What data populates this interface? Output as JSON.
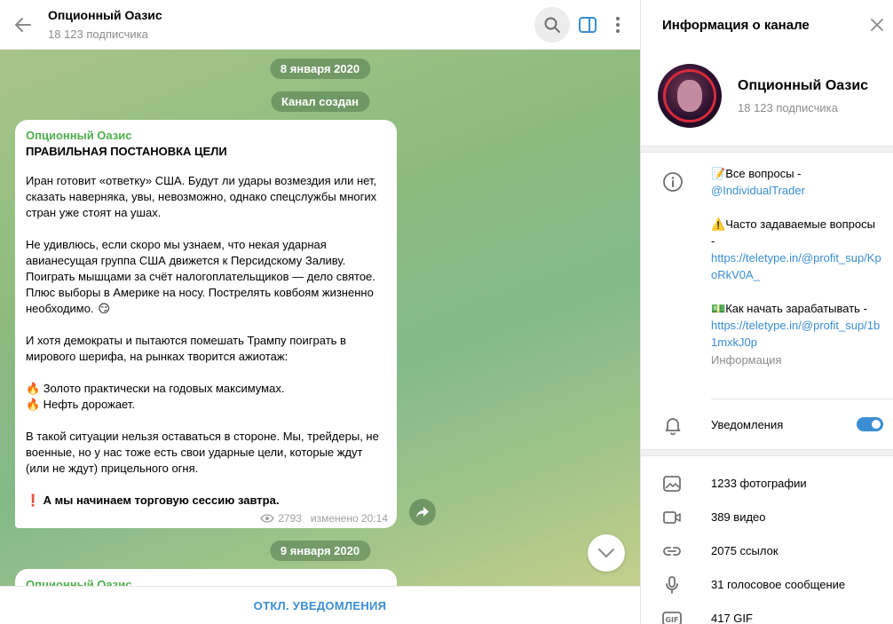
{
  "chat": {
    "title": "Опционный Оазис",
    "subscribers": "18 123 подписчика",
    "date_pill_1": "8 января 2020",
    "created_pill": "Канал создан",
    "date_pill_2": "9 января 2020",
    "bottom_action": "ОТКЛ. УВЕДОМЛЕНИЯ"
  },
  "message": {
    "author": "Опционный Оазис",
    "title": "ПРАВИЛЬНАЯ ПОСТАНОВКА ЦЕЛИ",
    "p1": "Иран готовит «ответку» США. Будут ли удары возмездия или нет, сказать наверняка, увы, невозможно, однако спецслужбы многих стран уже стоят на ушах.",
    "p2": "Не удивлюсь, если скоро мы узнаем, что некая ударная авианесущая группа США движется к Персидскому Заливу. Поиграть мышцами за счёт налогоплательщиков — дело святое. Плюс выборы в Америке на носу. Пострелять ковбоям жизненно необходимо.",
    "p2_emoji": "😏",
    "p3": "И хотя демократы и пытаются помешать Трампу поиграть в мирового шерифа, на рынках творится ажиотаж:",
    "bullet_emoji": "🔥",
    "bullet1": "Золото практически на годовых максимумах.",
    "bullet2": "Нефть дорожает.",
    "p4": "В такой ситуации нельзя оставаться в стороне. Мы, трейдеры, не военные, но у нас тоже есть свои ударные цели, которые ждут (или не ждут) прицельного огня.",
    "last_emoji": "❗",
    "last": "А мы начинаем торговую сессию завтра.",
    "views": "2793",
    "edited": "изменено 20:14"
  },
  "message2": {
    "author": "Опционный Оазис"
  },
  "info": {
    "header": "Информация о канале",
    "name": "Опционный Оазис",
    "subscribers": "18 123 подписчика",
    "about_line1_emoji": "📝",
    "about_line1": "Все вопросы -",
    "about_link1": "@IndividualTrader",
    "about_line2_emoji": "⚠️",
    "about_line2": "Часто задаваемые вопросы -",
    "about_link2": "https://teletype.in/@profit_sup/KpoRkV0A_",
    "about_line3_emoji": "💵",
    "about_line3": "Как начать зарабатывать -",
    "about_link3": "https://teletype.in/@profit_sup/1b1mxkJ0p",
    "about_label": "Информация",
    "notifications": "Уведомления",
    "notifications_on": true,
    "media": [
      {
        "label": "1233 фотографии",
        "icon": "photo-icon"
      },
      {
        "label": "389 видео",
        "icon": "video-icon"
      },
      {
        "label": "2075 ссылок",
        "icon": "link-icon"
      },
      {
        "label": "31 голосовое сообщение",
        "icon": "mic-icon"
      },
      {
        "label": "417 GIF",
        "icon": "gif-icon"
      }
    ]
  },
  "colors": {
    "accent": "#3a8ed3",
    "author": "#4fae4e",
    "muted": "#8d8d8d"
  }
}
